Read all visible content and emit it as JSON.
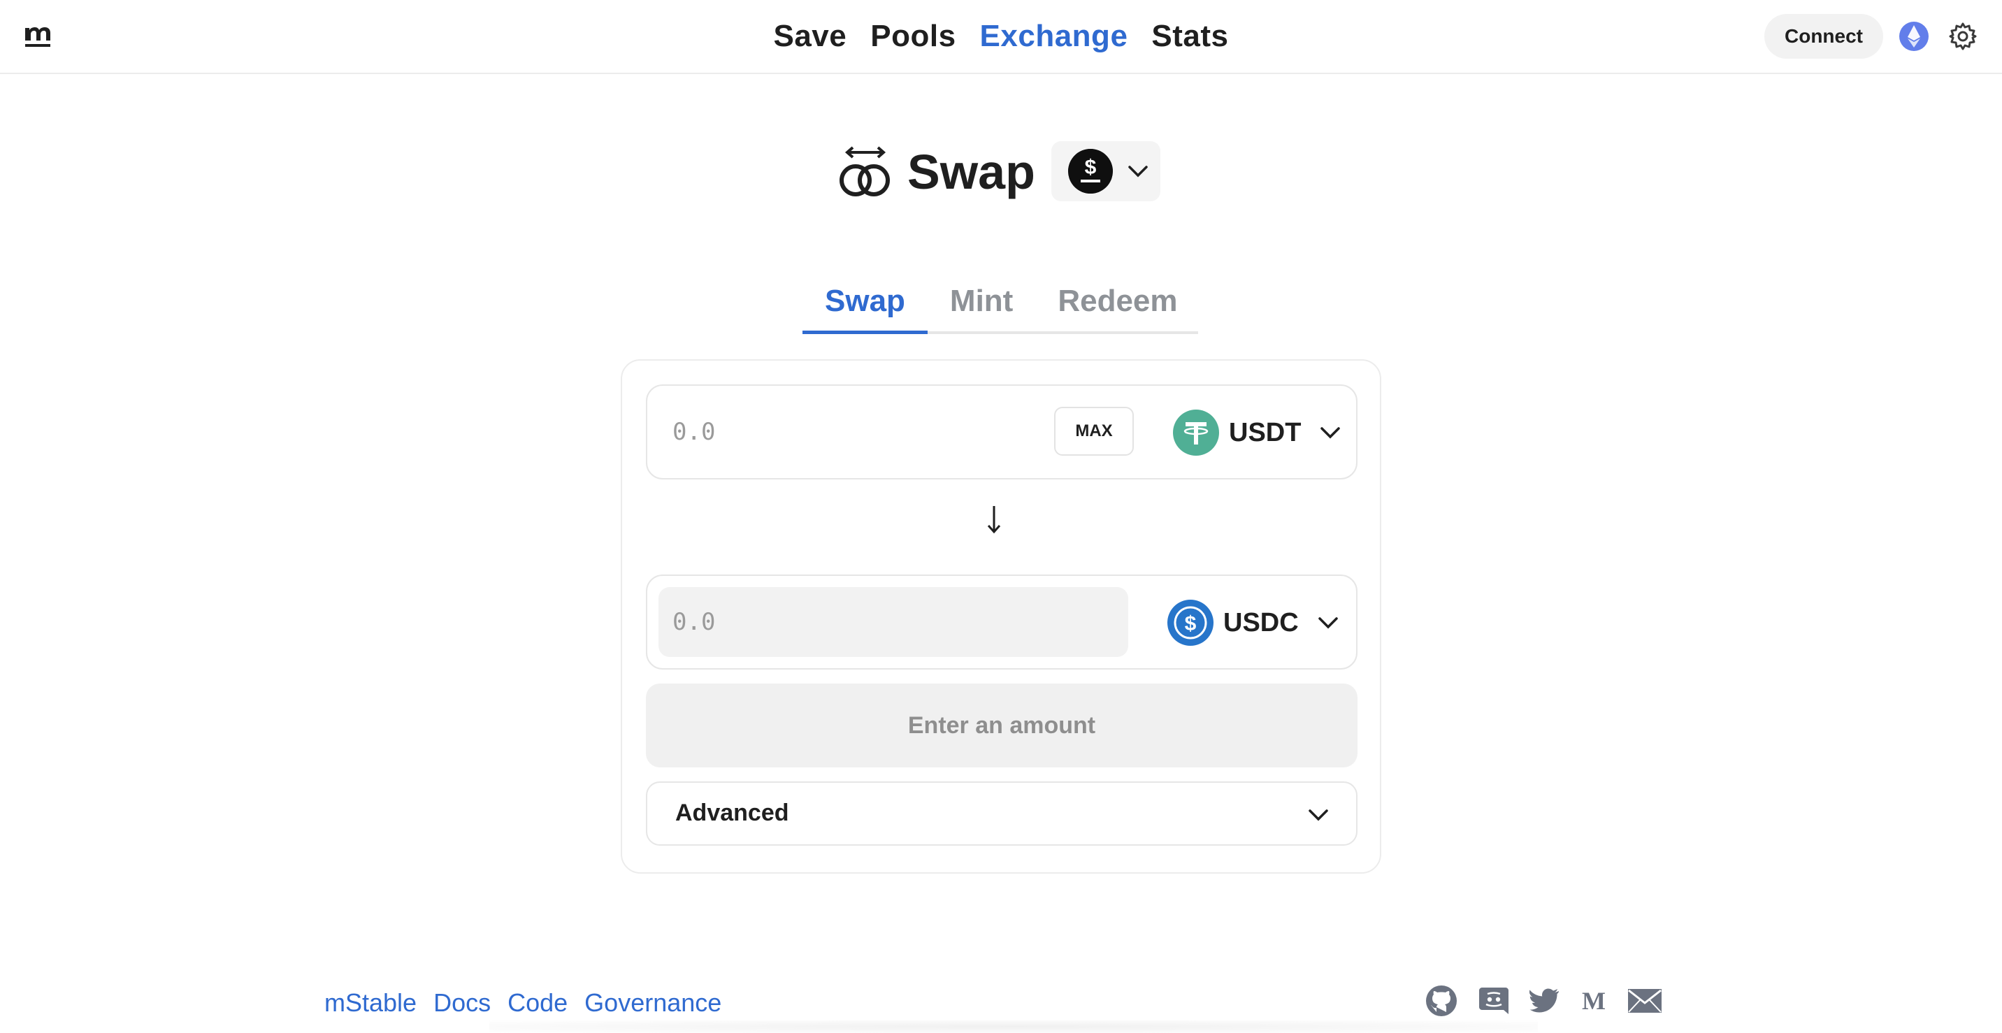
{
  "header": {
    "nav": [
      "Save",
      "Pools",
      "Exchange",
      "Stats"
    ],
    "active_nav": "Exchange",
    "connect_label": "Connect"
  },
  "page": {
    "title": "Swap"
  },
  "tabs": [
    "Swap",
    "Mint",
    "Redeem"
  ],
  "active_tab": "Swap",
  "swap_form": {
    "input_placeholder": "0.0",
    "max_label": "MAX",
    "input_token": "USDT",
    "output_placeholder": "0.0",
    "output_token": "USDC",
    "submit_label": "Enter an amount",
    "advanced_label": "Advanced"
  },
  "footer": {
    "links": [
      "mStable",
      "Docs",
      "Code",
      "Governance"
    ],
    "socials": [
      "github-icon",
      "discord-icon",
      "twitter-icon",
      "medium-icon",
      "email-icon"
    ]
  },
  "colors": {
    "accent": "#2f6ad0",
    "usdt_green": "#50af95",
    "usdc_blue": "#2775ca",
    "eth_purple": "#627eea"
  }
}
